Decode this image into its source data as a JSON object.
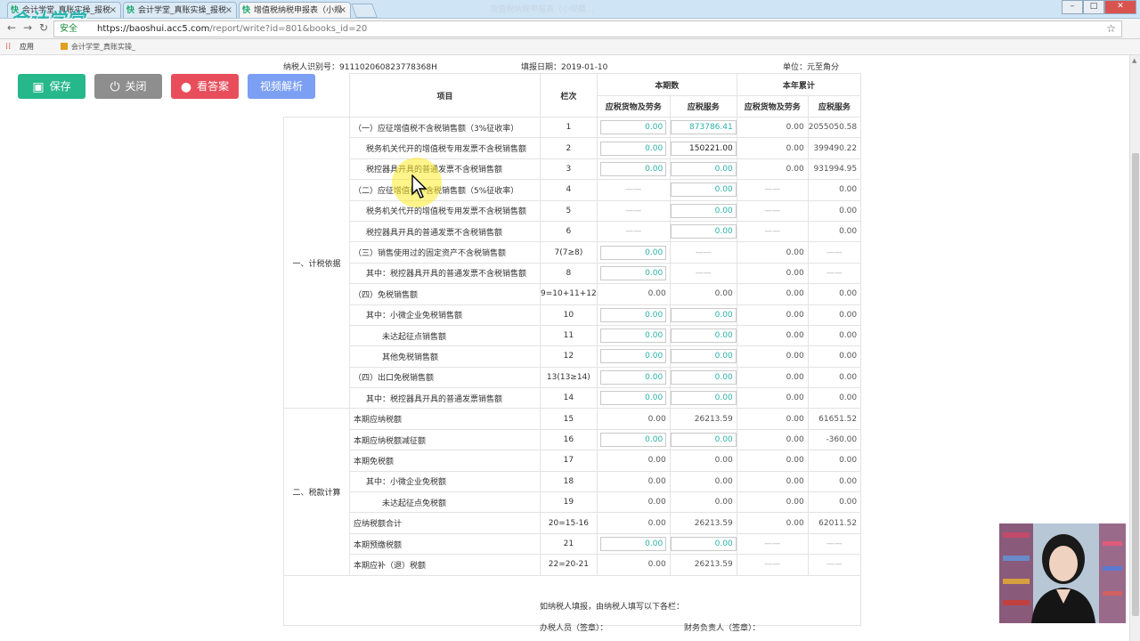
{
  "browser": {
    "tabs": [
      {
        "label": "会计学堂_真账实操_报税"
      },
      {
        "label": "会计学堂_真账实操_报税"
      },
      {
        "label": "增值税纳税申报表（小规"
      }
    ],
    "tab_favicon": "快",
    "window_title": "增值税纳税申报表（小规模…",
    "secure_label": "安全",
    "url_host": "https://baoshui.acc5.com",
    "url_path": "/report/write?id=801&books_id=20",
    "bookmark_apps": "应用",
    "bookmark_site": "会计学堂_真账实操_",
    "logo": "会计学堂"
  },
  "toolbar": {
    "save": "保存",
    "close": "关闭",
    "answer": "看答案",
    "video": "视频解析"
  },
  "header": {
    "taxpayer_id": "纳税人识别号：91110206082377836​8H",
    "fill_date": "填报日期：2019-01-10",
    "unit": "单位：元至角分"
  },
  "table": {
    "col_item": "项目",
    "col_no": "栏次",
    "col_current": "本期数",
    "col_ytd": "本年累计",
    "col_goods": "应税货物及劳务",
    "col_service": "应税服务",
    "section1": "一、计税依据",
    "section2": "二、税款计算",
    "rows": [
      {
        "item": "（一）应征增值税不含税销售额（3%征收率）",
        "no": "1",
        "cur_goods": "0.00",
        "cur_service": "873786.41",
        "ytd_goods": "0.00",
        "ytd_service": "2055050.58"
      },
      {
        "item": "税务机关代开的增值税专用发票不含税销售额",
        "no": "2",
        "cur_goods": "0.00",
        "cur_service": "150221.00",
        "ytd_goods": "0.00",
        "ytd_service": "399490.22"
      },
      {
        "item": "税控器具开具的普通发票不含税销售额",
        "no": "3",
        "cur_goods": "0.00",
        "cur_service": "0.00",
        "ytd_goods": "0.00",
        "ytd_service": "931994.95"
      },
      {
        "item": "（二）应征增值税不含税销售额（5%征收率）",
        "no": "4",
        "cur_goods": "——",
        "cur_service": "0.00",
        "ytd_goods": "——",
        "ytd_service": "0.00"
      },
      {
        "item": "税务机关代开的增值税专用发票不含税销售额",
        "no": "5",
        "cur_goods": "——",
        "cur_service": "0.00",
        "ytd_goods": "——",
        "ytd_service": "0.00"
      },
      {
        "item": "税控器具开具的普通发票不含税销售额",
        "no": "6",
        "cur_goods": "——",
        "cur_service": "0.00",
        "ytd_goods": "——",
        "ytd_service": "0.00"
      },
      {
        "item": "（三）销售使用过的固定资产不含税销售额",
        "no": "7(7≥8)",
        "cur_goods": "0.00",
        "cur_service": "——",
        "ytd_goods": "0.00",
        "ytd_service": "——"
      },
      {
        "item": "其中：税控器具开具的普通发票不含税销售额",
        "no": "8",
        "cur_goods": "0.00",
        "cur_service": "——",
        "ytd_goods": "0.00",
        "ytd_service": "——"
      },
      {
        "item": "（四）免税销售额",
        "no": "9=10+11+12",
        "cur_goods": "0.00",
        "cur_service": "0.00",
        "ytd_goods": "0.00",
        "ytd_service": "0.00"
      },
      {
        "item": "其中：小微企业免税销售额",
        "no": "10",
        "cur_goods": "0.00",
        "cur_service": "0.00",
        "ytd_goods": "0.00",
        "ytd_service": "0.00"
      },
      {
        "item": "未达起征点销售额",
        "no": "11",
        "cur_goods": "0.00",
        "cur_service": "0.00",
        "ytd_goods": "0.00",
        "ytd_service": "0.00"
      },
      {
        "item": "其他免税销售额",
        "no": "12",
        "cur_goods": "0.00",
        "cur_service": "0.00",
        "ytd_goods": "0.00",
        "ytd_service": "0.00"
      },
      {
        "item": "（四）出口免税销售额",
        "no": "13(13≥14)",
        "cur_goods": "0.00",
        "cur_service": "0.00",
        "ytd_goods": "0.00",
        "ytd_service": "0.00"
      },
      {
        "item": "其中：税控器具开具的普通发票销售额",
        "no": "14",
        "cur_goods": "0.00",
        "cur_service": "0.00",
        "ytd_goods": "0.00",
        "ytd_service": "0.00"
      },
      {
        "item": "本期应纳税额",
        "no": "15",
        "cur_goods": "0.00",
        "cur_service": "26213.59",
        "ytd_goods": "0.00",
        "ytd_service": "61651.52"
      },
      {
        "item": "本期应纳税额减征额",
        "no": "16",
        "cur_goods": "0.00",
        "cur_service": "0.00",
        "ytd_goods": "0.00",
        "ytd_service": "-360.00"
      },
      {
        "item": "本期免税额",
        "no": "17",
        "cur_goods": "0.00",
        "cur_service": "0.00",
        "ytd_goods": "0.00",
        "ytd_service": "0.00"
      },
      {
        "item": "其中：小微企业免税额",
        "no": "18",
        "cur_goods": "0.00",
        "cur_service": "0.00",
        "ytd_goods": "0.00",
        "ytd_service": "0.00"
      },
      {
        "item": "未达起征点免税额",
        "no": "19",
        "cur_goods": "0.00",
        "cur_service": "0.00",
        "ytd_goods": "0.00",
        "ytd_service": "0.00"
      },
      {
        "item": "应纳税额合计",
        "no": "20=15-16",
        "cur_goods": "0.00",
        "cur_service": "26213.59",
        "ytd_goods": "0.00",
        "ytd_service": "62011.52"
      },
      {
        "item": "本期预缴税额",
        "no": "21",
        "cur_goods": "0.00",
        "cur_service": "0.00",
        "ytd_goods": "——",
        "ytd_service": "——"
      },
      {
        "item": "本期应补（退）税额",
        "no": "22=20-21",
        "cur_goods": "0.00",
        "cur_service": "26213.59",
        "ytd_goods": "——",
        "ytd_service": "——"
      }
    ]
  },
  "footer": {
    "line1": "如纳税人填报，由纳税人填写以下各栏：",
    "handler": "办税人员（签章）：",
    "finance": "财务负责人（签章）："
  }
}
